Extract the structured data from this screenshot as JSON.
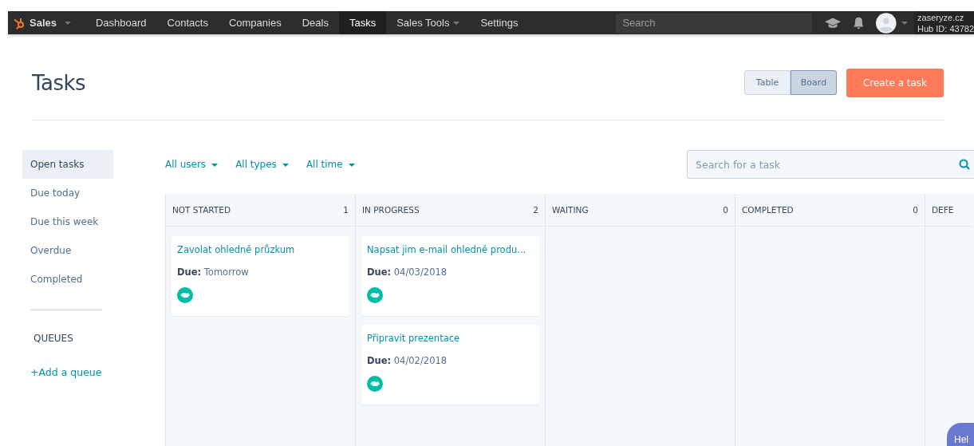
{
  "nav": {
    "app": {
      "label": "Sales",
      "has_menu": true
    },
    "items": [
      {
        "label": "Dashboard",
        "selected": false,
        "has_menu": false
      },
      {
        "label": "Contacts",
        "selected": false,
        "has_menu": false
      },
      {
        "label": "Companies",
        "selected": false,
        "has_menu": false
      },
      {
        "label": "Deals",
        "selected": false,
        "has_menu": false
      },
      {
        "label": "Tasks",
        "selected": true,
        "has_menu": false
      },
      {
        "label": "Sales Tools",
        "selected": false,
        "has_menu": true
      },
      {
        "label": "Settings",
        "selected": false,
        "has_menu": false
      }
    ],
    "search": {
      "placeholder": "Search"
    },
    "account": {
      "domain": "zaseryze.cz",
      "hub_id": "Hub ID: 43782"
    }
  },
  "page": {
    "title": "Tasks",
    "views": [
      {
        "label": "Table",
        "selected": false
      },
      {
        "label": "Board",
        "selected": true
      }
    ],
    "create_button": "Create a task"
  },
  "sidebar": {
    "items": [
      {
        "label": "Open tasks",
        "selected": true
      },
      {
        "label": "Due today",
        "selected": false
      },
      {
        "label": "Due this week",
        "selected": false
      },
      {
        "label": "Overdue",
        "selected": false
      },
      {
        "label": "Completed",
        "selected": false
      }
    ],
    "queues_heading": "QUEUES",
    "add_queue": "+Add a queue"
  },
  "filters": [
    "All users",
    "All types",
    "All time"
  ],
  "task_search": {
    "placeholder": "Search for a task"
  },
  "board": {
    "columns": [
      {
        "title": "NOT STARTED",
        "count": "1",
        "cards": [
          {
            "title": "Zavolat ohledně průzkum",
            "due": "**Due:** Tomorrow"
          }
        ]
      },
      {
        "title": "IN PROGRESS",
        "count": "2",
        "cards": [
          {
            "title": "Napsat jim e-mail ohledně produ...",
            "due": "**Due:** 04/03/2018"
          },
          {
            "title": "Připravit prezentace",
            "due": "**Due:** 04/02/2018"
          }
        ]
      },
      {
        "title": "WAITING",
        "count": "0"
      },
      {
        "title": "COMPLETED",
        "count": "0"
      },
      {
        "title": "DEFE"
      }
    ]
  },
  "help_button": "Hel"
}
